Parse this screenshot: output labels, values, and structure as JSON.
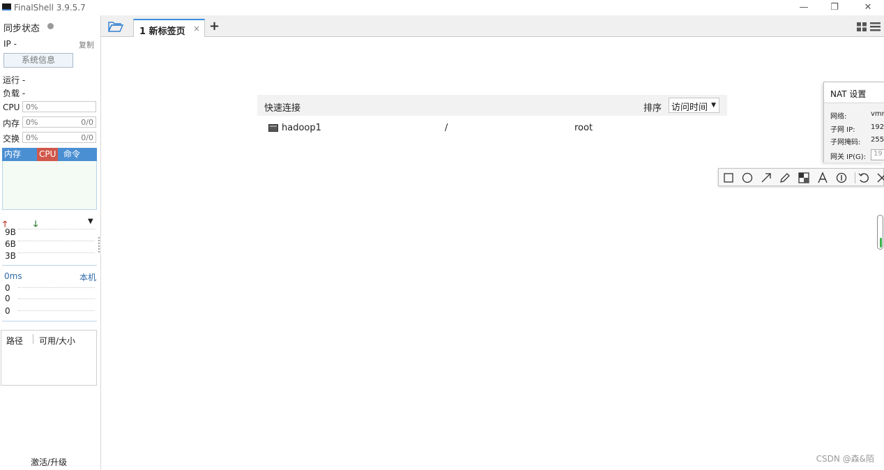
{
  "window": {
    "title": "FinalShell 3.9.5.7",
    "minimize": "—",
    "restore": "❐",
    "close": "✕"
  },
  "sidebar": {
    "sync_status": "同步状态",
    "ip_label": "IP  -",
    "copy": "复制",
    "system_info": "系统信息",
    "run": "运行 -",
    "load": "负载 -",
    "cpu": {
      "label": "CPU",
      "percent": "0%",
      "ratio": ""
    },
    "memory": {
      "label": "内存",
      "percent": "0%",
      "ratio": "0/0"
    },
    "swap": {
      "label": "交换",
      "percent": "0%",
      "ratio": "0/0"
    },
    "process_tabs": [
      "内存",
      "CPU",
      "命令"
    ],
    "net_scale": [
      "9B",
      "6B",
      "3B"
    ],
    "latency": "0ms",
    "host": "本机",
    "ping_values": [
      "0",
      "0",
      "0"
    ],
    "disk_headers": [
      "路径",
      "可用/大小"
    ],
    "activate": "激活/升级"
  },
  "tabs": {
    "items": [
      {
        "label": "1 新标签页",
        "close": "×"
      }
    ],
    "add": "+"
  },
  "quick_connect": {
    "title": "快速连接",
    "sort_label": "排序",
    "sort_value": "访问时间",
    "connections": [
      {
        "name": "hadoop1",
        "path": "/",
        "user": "root"
      }
    ]
  },
  "nat_dialog": {
    "title": "NAT 设置",
    "rows": [
      {
        "label": "网络:",
        "value": "vmn"
      },
      {
        "label": "子网 IP:",
        "value": "192."
      },
      {
        "label": "子网掩码:",
        "value": "255."
      },
      {
        "label": "网关 IP(G):",
        "value": "19"
      }
    ]
  },
  "annotation_tools": [
    "rectangle-icon",
    "ellipse-icon",
    "arrow-icon",
    "pen-icon",
    "mosaic-icon",
    "text-icon",
    "number-icon",
    "undo-icon",
    "exit-icon"
  ],
  "watermark": "CSDN @森&陌",
  "colors": {
    "accent": "#3c8fe0",
    "proc_tab_bg": "#4b8fd3",
    "cpu_tab_bg": "#d0584a",
    "upload": "#c0392b",
    "download": "#2b7a2b",
    "link_blue": "#2d6aa8"
  }
}
